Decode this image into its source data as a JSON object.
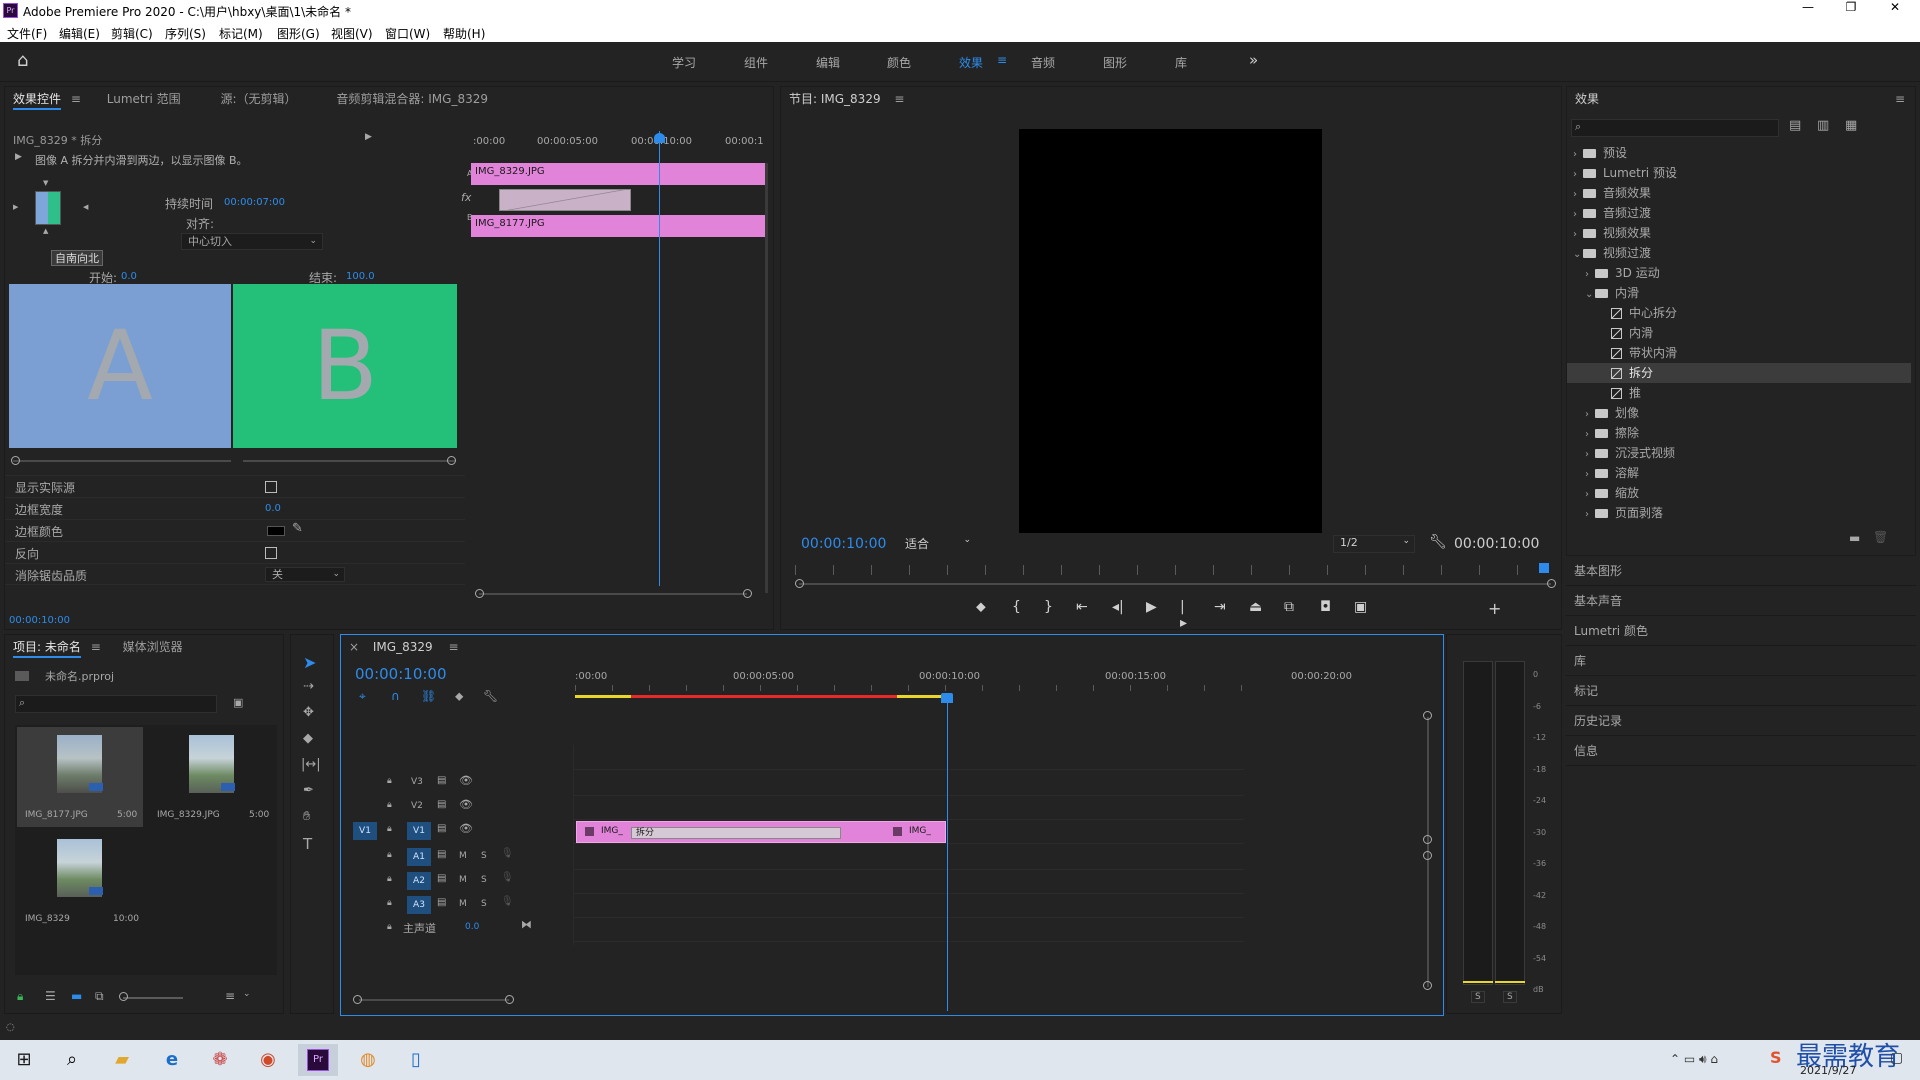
{
  "title": "Adobe Premiere Pro 2020 - C:\\用户\\hbxy\\桌面\\1\\未命名 *",
  "menu": [
    "文件(F)",
    "编辑(E)",
    "剪辑(C)",
    "序列(S)",
    "标记(M)",
    "图形(G)",
    "视图(V)",
    "窗口(W)",
    "帮助(H)"
  ],
  "workspaces": [
    "学习",
    "组件",
    "编辑",
    "颜色",
    "效果",
    "音频",
    "图形",
    "库"
  ],
  "active_workspace": "效果",
  "effect_controls": {
    "tabs": [
      "效果控件",
      "Lumetri 范围",
      "源:（无剪辑）",
      "音频剪辑混合器: IMG_8329"
    ],
    "clip_title": "IMG_8329 * 拆分",
    "description": "图像 A 拆分并内滑到两边，以显示图像 B。",
    "duration_label": "持续时间",
    "duration_value": "00:00:07:00",
    "align_label": "对齐:",
    "align_value": "中心切入",
    "tooltip": "自南向北",
    "start_label": "开始:",
    "start_value": "0.0",
    "end_label": "结束:",
    "end_value": "100.0",
    "preview_a": "A",
    "preview_b": "B",
    "mini_time": [
      ":00:00",
      "00:00:05:00",
      "00:00:10:00",
      "00:00:1"
    ],
    "track_a": "A",
    "track_b": "B",
    "clip_a": "IMG_8329.JPG",
    "clip_b": "IMG_8177.JPG",
    "props": [
      {
        "label": "显示实际源",
        "type": "checkbox"
      },
      {
        "label": "边框宽度",
        "type": "value",
        "value": "0.0"
      },
      {
        "label": "边框颜色",
        "type": "color"
      },
      {
        "label": "反向",
        "type": "checkbox"
      },
      {
        "label": "消除锯齿品质",
        "type": "select",
        "value": "关"
      }
    ],
    "footer_time": "00:00:10:00"
  },
  "program": {
    "title": "节目: IMG_8329",
    "timecode": "00:00:10:00",
    "fit": "适合",
    "resolution": "1/2",
    "duration": "00:00:10:00"
  },
  "effects_panel": {
    "title": "效果",
    "tree": [
      {
        "label": "预设",
        "level": 0,
        "kind": "folder",
        "open": false
      },
      {
        "label": "Lumetri 预设",
        "level": 0,
        "kind": "folder",
        "open": false
      },
      {
        "label": "音频效果",
        "level": 0,
        "kind": "folder",
        "open": false
      },
      {
        "label": "音频过渡",
        "level": 0,
        "kind": "folder",
        "open": false
      },
      {
        "label": "视频效果",
        "level": 0,
        "kind": "folder",
        "open": false
      },
      {
        "label": "视频过渡",
        "level": 0,
        "kind": "folder",
        "open": true
      },
      {
        "label": "3D 运动",
        "level": 1,
        "kind": "folder",
        "open": false
      },
      {
        "label": "内滑",
        "level": 1,
        "kind": "folder",
        "open": true
      },
      {
        "label": "中心拆分",
        "level": 2,
        "kind": "fx"
      },
      {
        "label": "内滑",
        "level": 2,
        "kind": "fx"
      },
      {
        "label": "带状内滑",
        "level": 2,
        "kind": "fx"
      },
      {
        "label": "拆分",
        "level": 2,
        "kind": "fx",
        "selected": true
      },
      {
        "label": "推",
        "level": 2,
        "kind": "fx"
      },
      {
        "label": "划像",
        "level": 1,
        "kind": "folder",
        "open": false
      },
      {
        "label": "擦除",
        "level": 1,
        "kind": "folder",
        "open": false
      },
      {
        "label": "沉浸式视频",
        "level": 1,
        "kind": "folder",
        "open": false
      },
      {
        "label": "溶解",
        "level": 1,
        "kind": "folder",
        "open": false
      },
      {
        "label": "缩放",
        "level": 1,
        "kind": "folder",
        "open": false
      },
      {
        "label": "页面剥落",
        "level": 1,
        "kind": "folder",
        "open": false
      }
    ],
    "sections": [
      "基本图形",
      "基本声音",
      "Lumetri 颜色",
      "库",
      "标记",
      "历史记录",
      "信息"
    ]
  },
  "project": {
    "tabs": [
      "项目: 未命名",
      "媒体浏览器"
    ],
    "file": "未命名.prproj",
    "items": [
      {
        "name": "IMG_8177.JPG",
        "dur": "5:00"
      },
      {
        "name": "IMG_8329.JPG",
        "dur": "5:00"
      },
      {
        "name": "IMG_8329",
        "dur": "10:00"
      }
    ]
  },
  "timeline": {
    "title": "IMG_8329",
    "timecode": "00:00:10:00",
    "ruler": [
      ":00:00",
      "00:00:05:00",
      "00:00:10:00",
      "00:00:15:00",
      "00:00:20:00"
    ],
    "tracks": [
      {
        "id": "V3",
        "type": "video"
      },
      {
        "id": "V2",
        "type": "video"
      },
      {
        "id": "V1",
        "type": "video",
        "src": "V1"
      },
      {
        "id": "A1",
        "type": "audio"
      },
      {
        "id": "A2",
        "type": "audio"
      },
      {
        "id": "A3",
        "type": "audio"
      }
    ],
    "master_label": "主声道",
    "master_value": "0.0",
    "clip_left": "IMG_",
    "clip_right": "IMG_",
    "transition_label": "拆分",
    "mute": "M",
    "solo": "S"
  },
  "meter": {
    "ticks": [
      "0",
      "-6",
      "-12",
      "-18",
      "-24",
      "-30",
      "-36",
      "-42",
      "-48",
      "-54",
      "dB"
    ],
    "solo": [
      "S",
      "S"
    ]
  },
  "taskbar": {
    "date": "2021/9/27",
    "watermark": "最需教育"
  }
}
